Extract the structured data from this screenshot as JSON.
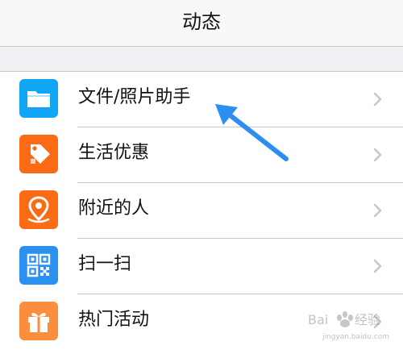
{
  "header": {
    "title": "动态"
  },
  "list": {
    "items": [
      {
        "label": "文件/照片助手",
        "icon": "folder-icon",
        "color": "#11a5f5"
      },
      {
        "label": "生活优惠",
        "icon": "price-tag-icon",
        "color": "#fb6a14"
      },
      {
        "label": "附近的人",
        "icon": "location-pin-icon",
        "color": "#fb6a14"
      },
      {
        "label": "扫一扫",
        "icon": "qr-code-icon",
        "color": "#2a90f2"
      },
      {
        "label": "热门活动",
        "icon": "gift-icon",
        "color": "#fb8e3c"
      }
    ]
  },
  "annotation": {
    "arrow_color": "#2b8ef0"
  },
  "watermark": {
    "text": "Baidu 经验",
    "url": "jingyan.baidu.com"
  }
}
